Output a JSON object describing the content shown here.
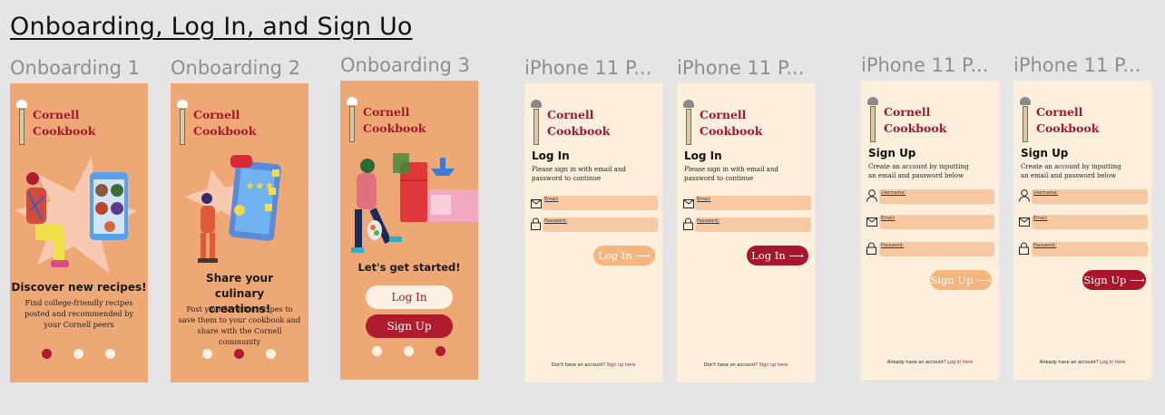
{
  "page": {
    "title": "Onboarding, Log In, and Sign Uo"
  },
  "brand": {
    "line1": "Cornell",
    "line2": "Cookbook"
  },
  "frames": {
    "onb1": {
      "label": "Onboarding 1",
      "headline": "Discover new recipes!",
      "body": "Find college-friendly recipes posted and recommended by your Cornell peers",
      "active_dot": 0
    },
    "onb2": {
      "label": "Onboarding 2",
      "headline": "Share your culinary creations!",
      "body": "Post your favorite recipes to save them to your cookbook and share with the Cornell community",
      "active_dot": 1
    },
    "onb3": {
      "label": "Onboarding 3",
      "headline": "Let's get started!",
      "login_label": "Log In",
      "signup_label": "Sign Up",
      "active_dot": 2
    },
    "login1": {
      "label": "iPhone 11 P...",
      "title": "Log In",
      "subtitle": "Please sign in with email and password to continue",
      "email_label": "Email:",
      "password_label": "Password:",
      "button_label": "Log In",
      "footer_text": "Don't have an account?",
      "footer_link": "Sign up here"
    },
    "login2": {
      "label": "iPhone 11 P...",
      "title": "Log In",
      "subtitle": "Please sign in with email and password to continue",
      "email_label": "Email:",
      "password_label": "Password:",
      "button_label": "Log In",
      "footer_text": "Don't have an account?",
      "footer_link": "Sign up here"
    },
    "signup1": {
      "label": "iPhone 11 P...",
      "title": "Sign Up",
      "subtitle": "Create an account by inputting an email and password below",
      "username_label": "Username:",
      "email_label": "Email:",
      "password_label": "Password:",
      "button_label": "Sign Up",
      "footer_text": "Already have an account?",
      "footer_link": "Log in here"
    },
    "signup2": {
      "label": "iPhone 11 P...",
      "title": "Sign Up",
      "subtitle": "Create an account by inputting an email and password below",
      "username_label": "Username:",
      "email_label": "Email:",
      "password_label": "Password:",
      "button_label": "Sign Up",
      "footer_text": "Already have an account?",
      "footer_link": "Log in here"
    }
  },
  "colors": {
    "orange_bg": "#eda876",
    "cream_bg": "#fdefdb",
    "brand_red": "#a8162c",
    "field_bg": "#f7c9a2",
    "disabled_button": "#f4b57f"
  }
}
